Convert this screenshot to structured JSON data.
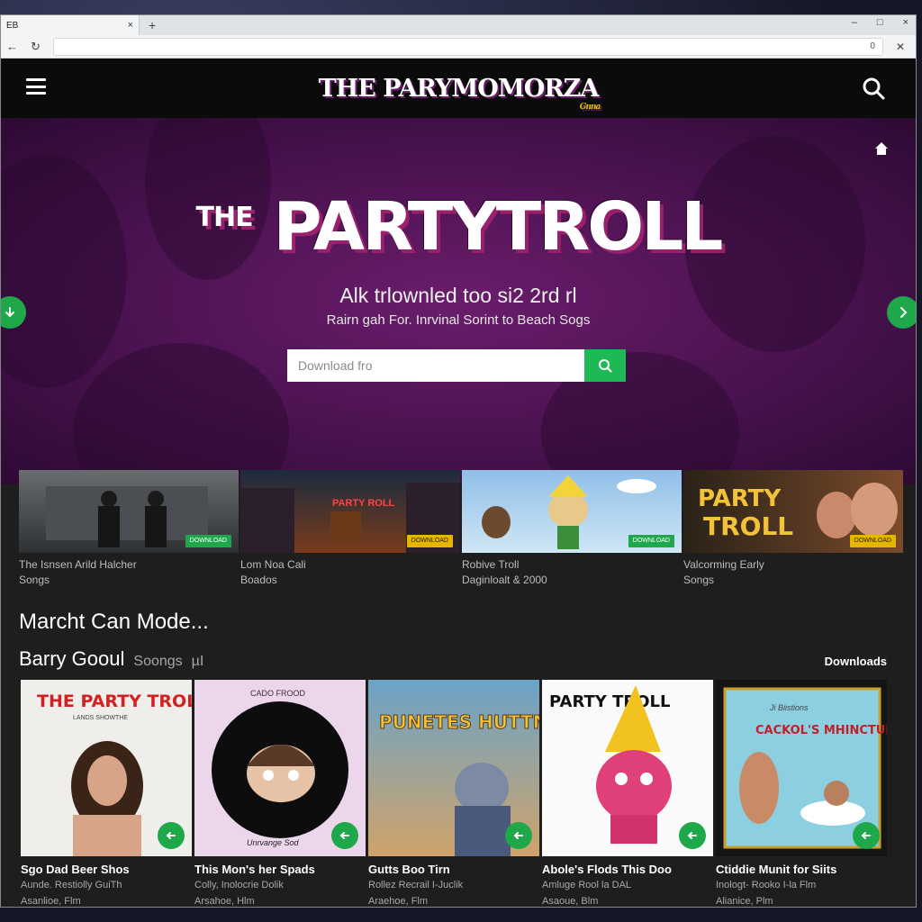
{
  "browser": {
    "tab_title": "EB",
    "tab_close": "×",
    "new_tab": "+",
    "window_controls": [
      "–",
      "□",
      "×"
    ],
    "url_indicator": "0"
  },
  "site": {
    "logo_text": "THE PARYMOMORZA",
    "logo_sub": "Gnna"
  },
  "hero": {
    "title_small": "THE",
    "title_big": "PARTYTROLL",
    "subtitle": "Alk trlownled too si2 2rd rl",
    "description": "Rairn gah For. Inrvinal Sorint to Beach Sogs",
    "search_placeholder": "Download fro"
  },
  "featured": [
    {
      "line1": "The Isnsen Arild Halcher",
      "line2": "Songs",
      "tag": "DOWNLOAD",
      "tag_color": "#1ea84a"
    },
    {
      "line1": "Lom Noa Cali",
      "line2": "Boados",
      "tag": "DOWNLOAD",
      "tag_color": "#e7b400"
    },
    {
      "line1": "Robive Troll",
      "line2": "Daginloalt & 2000",
      "tag": "DOWNLOAD",
      "tag_color": "#1ea84a"
    },
    {
      "line1": "Valcorming Early",
      "line2": "Songs",
      "tag": "DOWNLOAD",
      "tag_color": "#e7b400"
    }
  ],
  "sections": {
    "heading1": "Marcht Can Mode...",
    "heading2": "Barry Gooul",
    "heading2_sub": "Soongs",
    "heading2_icon": "µI",
    "downloads_label": "Downloads"
  },
  "cards": [
    {
      "title": "Sgo Dad Beer Shos",
      "sub1": "Aunde. Restiolly GuiTh",
      "sub2": "Asanlioe, Flm",
      "cover_text": "THE PARTY TROLL",
      "cover_sub": "LANDS SHOWTHE"
    },
    {
      "title": "This Mon's her Spads",
      "sub1": "Colly, Inolocrie Dolik",
      "sub2": "Arsahoe, Hlm",
      "cover_text": "CADO FROOD",
      "cover_sub": "Unrvange Sod"
    },
    {
      "title": "Gutts Boo Tirn",
      "sub1": "Rollez Recrail I-Juclik",
      "sub2": "Araehoe, Flm",
      "cover_text": "PUNETES HUTTMES",
      "cover_sub": ""
    },
    {
      "title": "Abole's Flods This Doo",
      "sub1": "Amluge Rool la DAL",
      "sub2": "Asaoue, Blm",
      "cover_text": "PARTY TROLL",
      "cover_sub": ""
    },
    {
      "title": "Ctiddie Munit for Siits",
      "sub1": "Inologt- Rooko I-la Flm",
      "sub2": "Alianice, Plm",
      "cover_text": "CACKOL'S MHINCTUN",
      "cover_sub": "Ji Biistions"
    }
  ],
  "colors": {
    "accent_green": "#1ea84a",
    "hero_purple": "#4a1250",
    "header_black": "#0b0b0b",
    "page_dark": "#1e1e1e"
  }
}
